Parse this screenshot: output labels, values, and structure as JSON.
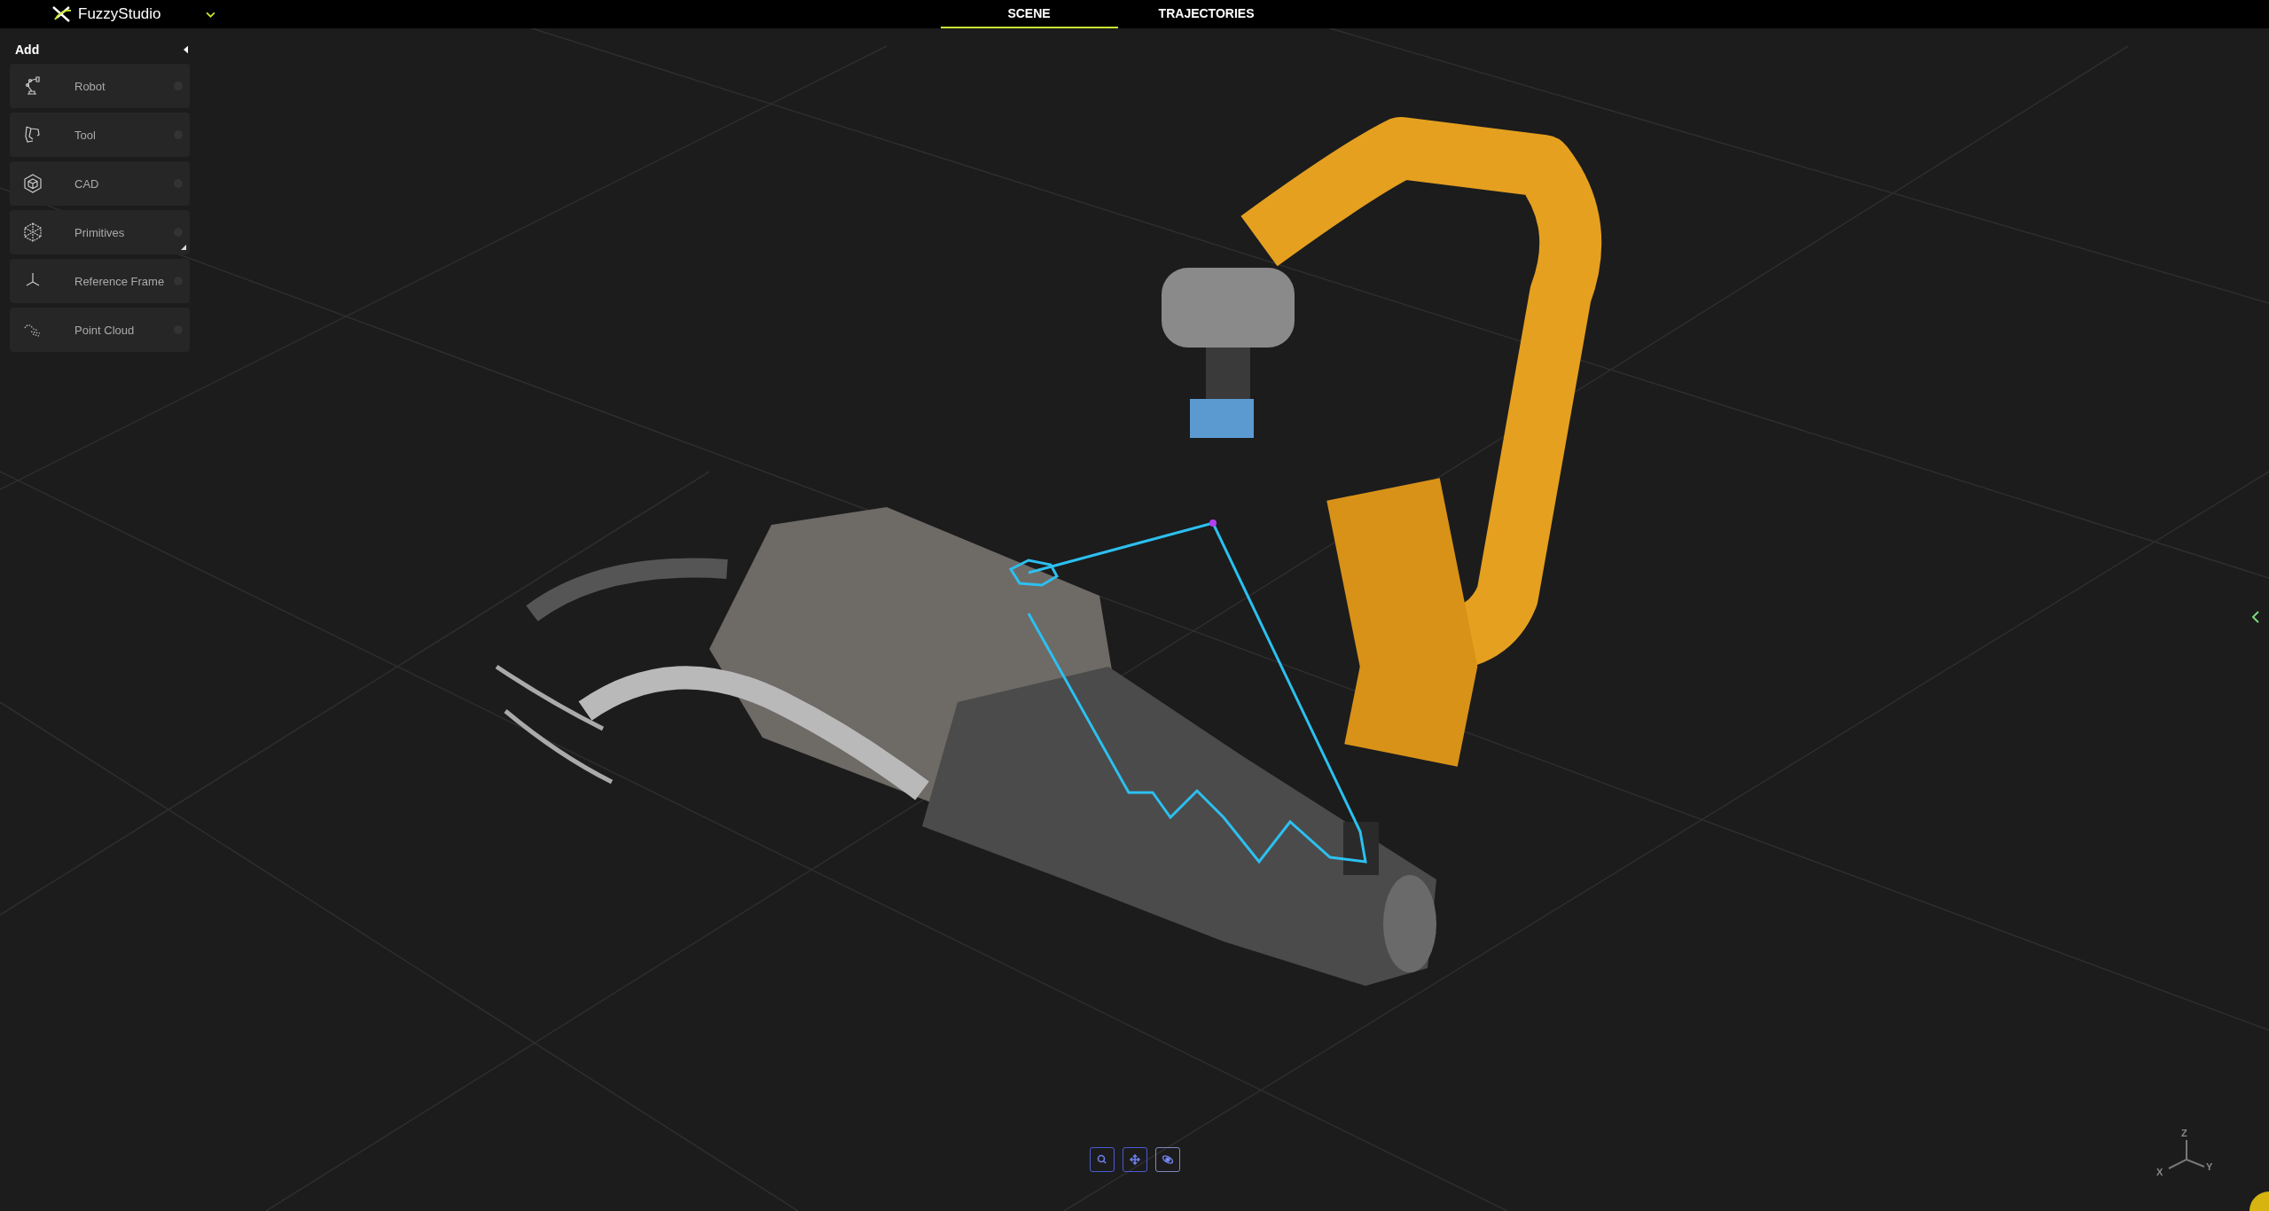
{
  "app": {
    "title": "FuzzyStudio"
  },
  "tabs": [
    {
      "label": "SCENE",
      "selected": true
    },
    {
      "label": "TRAJECTORIES",
      "selected": false
    }
  ],
  "sidebar": {
    "title": "Add",
    "items": [
      {
        "kind": "robot",
        "label": "Robot",
        "has_submenu": false
      },
      {
        "kind": "tool",
        "label": "Tool",
        "has_submenu": false
      },
      {
        "kind": "cad",
        "label": "CAD",
        "has_submenu": false
      },
      {
        "kind": "primitives",
        "label": "Primitives",
        "has_submenu": true
      },
      {
        "kind": "frame",
        "label": "Reference Frame",
        "has_submenu": false
      },
      {
        "kind": "pointcloud",
        "label": "Point Cloud",
        "has_submenu": false
      }
    ]
  },
  "view_tools": [
    {
      "kind": "zoom",
      "selected": false
    },
    {
      "kind": "pan",
      "selected": false
    },
    {
      "kind": "orbit",
      "selected": true
    }
  ],
  "axes": {
    "z": "Z",
    "x": "X",
    "y": "Y"
  }
}
